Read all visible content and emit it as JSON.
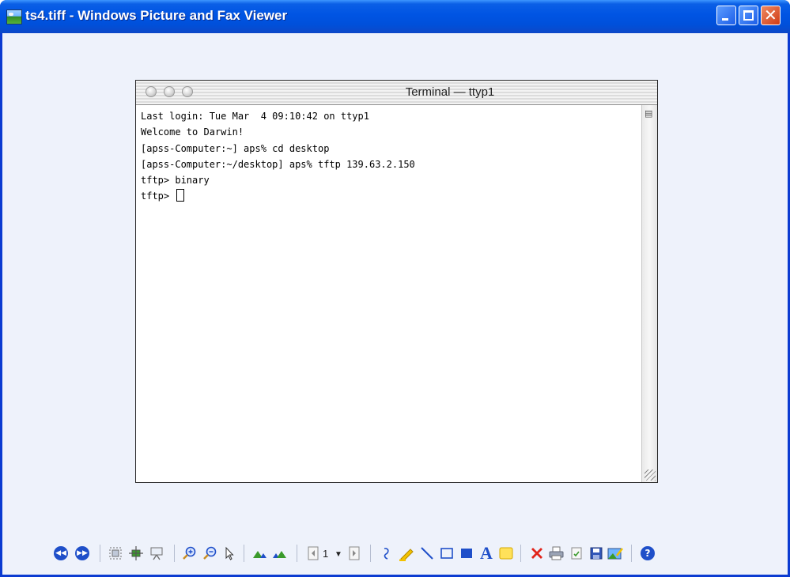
{
  "window": {
    "title": "ts4.tiff - Windows Picture and Fax Viewer",
    "app_icon": "picture-viewer-icon",
    "controls": [
      "minimize-icon",
      "maximize-icon",
      "close-icon"
    ]
  },
  "terminal": {
    "title": "Terminal — ttyp1",
    "lines": [
      "Last login: Tue Mar  4 09:10:42 on ttyp1",
      "Welcome to Darwin!",
      "[apss-Computer:~] aps% cd desktop",
      "[apss-Computer:~/desktop] aps% tftp 139.63.2.150",
      "tftp> binary"
    ],
    "prompt": "tftp>"
  },
  "toolbar": {
    "page_number": "1",
    "icons": [
      "previous-image-icon",
      "next-image-icon",
      "best-fit-icon",
      "actual-size-icon",
      "slideshow-icon",
      "zoom-in-icon",
      "zoom-out-icon",
      "select-icon",
      "rotate-clockwise-icon",
      "rotate-counterclockwise-icon",
      "previous-page-icon",
      "next-page-icon",
      "freehand-annotation-icon",
      "highlighter-icon",
      "line-icon",
      "rectangle-icon",
      "filled-rectangle-icon",
      "text-icon",
      "note-icon",
      "delete-icon",
      "print-icon",
      "copy-to-icon",
      "save-icon",
      "edit-icon",
      "help-icon"
    ],
    "colors": {
      "blue": "#1f4fc9",
      "red": "#e1251b",
      "yellow": "#f3c200",
      "green": "#3a9a2b"
    }
  }
}
